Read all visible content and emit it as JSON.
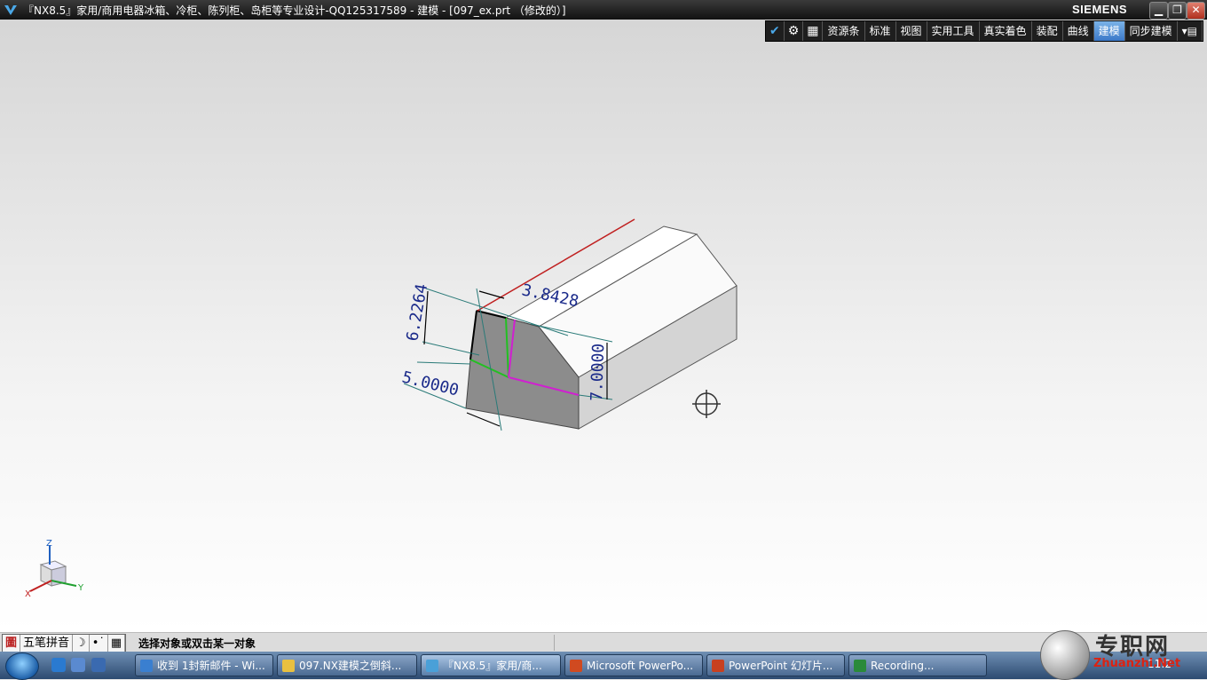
{
  "window": {
    "title": "『NX8.5』家用/商用电器冰箱、冷柜、陈列柜、岛柜等专业设计-QQ125317589 - 建模 - [097_ex.prt （修改的）]",
    "brand": "SIEMENS",
    "minimize": "▁",
    "restore": "❐",
    "close": "✕"
  },
  "ribbon": {
    "tabs": [
      {
        "label": "资源条"
      },
      {
        "label": "标准"
      },
      {
        "label": "视图"
      },
      {
        "label": "实用工具"
      },
      {
        "label": "真实着色"
      },
      {
        "label": "装配"
      },
      {
        "label": "曲线"
      },
      {
        "label": "建模",
        "active": true
      },
      {
        "label": "同步建模"
      }
    ],
    "more": "▾▤"
  },
  "model": {
    "dim_top": "3.8428",
    "dim_left_vertical": "6.2264",
    "dim_bottom": "5.0000",
    "dim_right_vertical": "7.0000"
  },
  "triad": {
    "z": "Z",
    "y": "Y",
    "x": "X"
  },
  "statusbar": {
    "ime_logo": "圖",
    "ime_name": "五笔拼音",
    "ime_moon": "☽",
    "ime_punct": "•˙",
    "ime_keyboard": "▦",
    "message": "选择对象或双击某一对象"
  },
  "taskbar": {
    "items": [
      {
        "label": "收到 1封新邮件 - Wi...",
        "color": "#3a7fd0"
      },
      {
        "label": "097.NX建模之倒斜...",
        "color": "#e8c040"
      },
      {
        "label": "『NX8.5』家用/商...",
        "color": "#4aa0d8",
        "active": true
      },
      {
        "label": "Microsoft PowerPo...",
        "color": "#d04a20"
      },
      {
        "label": "PowerPoint 幻灯片...",
        "color": "#c84020"
      },
      {
        "label": "Recording...",
        "color": "#2a8a3a"
      }
    ],
    "clock": "11:2"
  },
  "watermark": {
    "name": "专职网",
    "url": "Zhuanzhi.Net"
  },
  "colors": {
    "accent": "#3b78c8",
    "dim": "#1a2a8a"
  }
}
